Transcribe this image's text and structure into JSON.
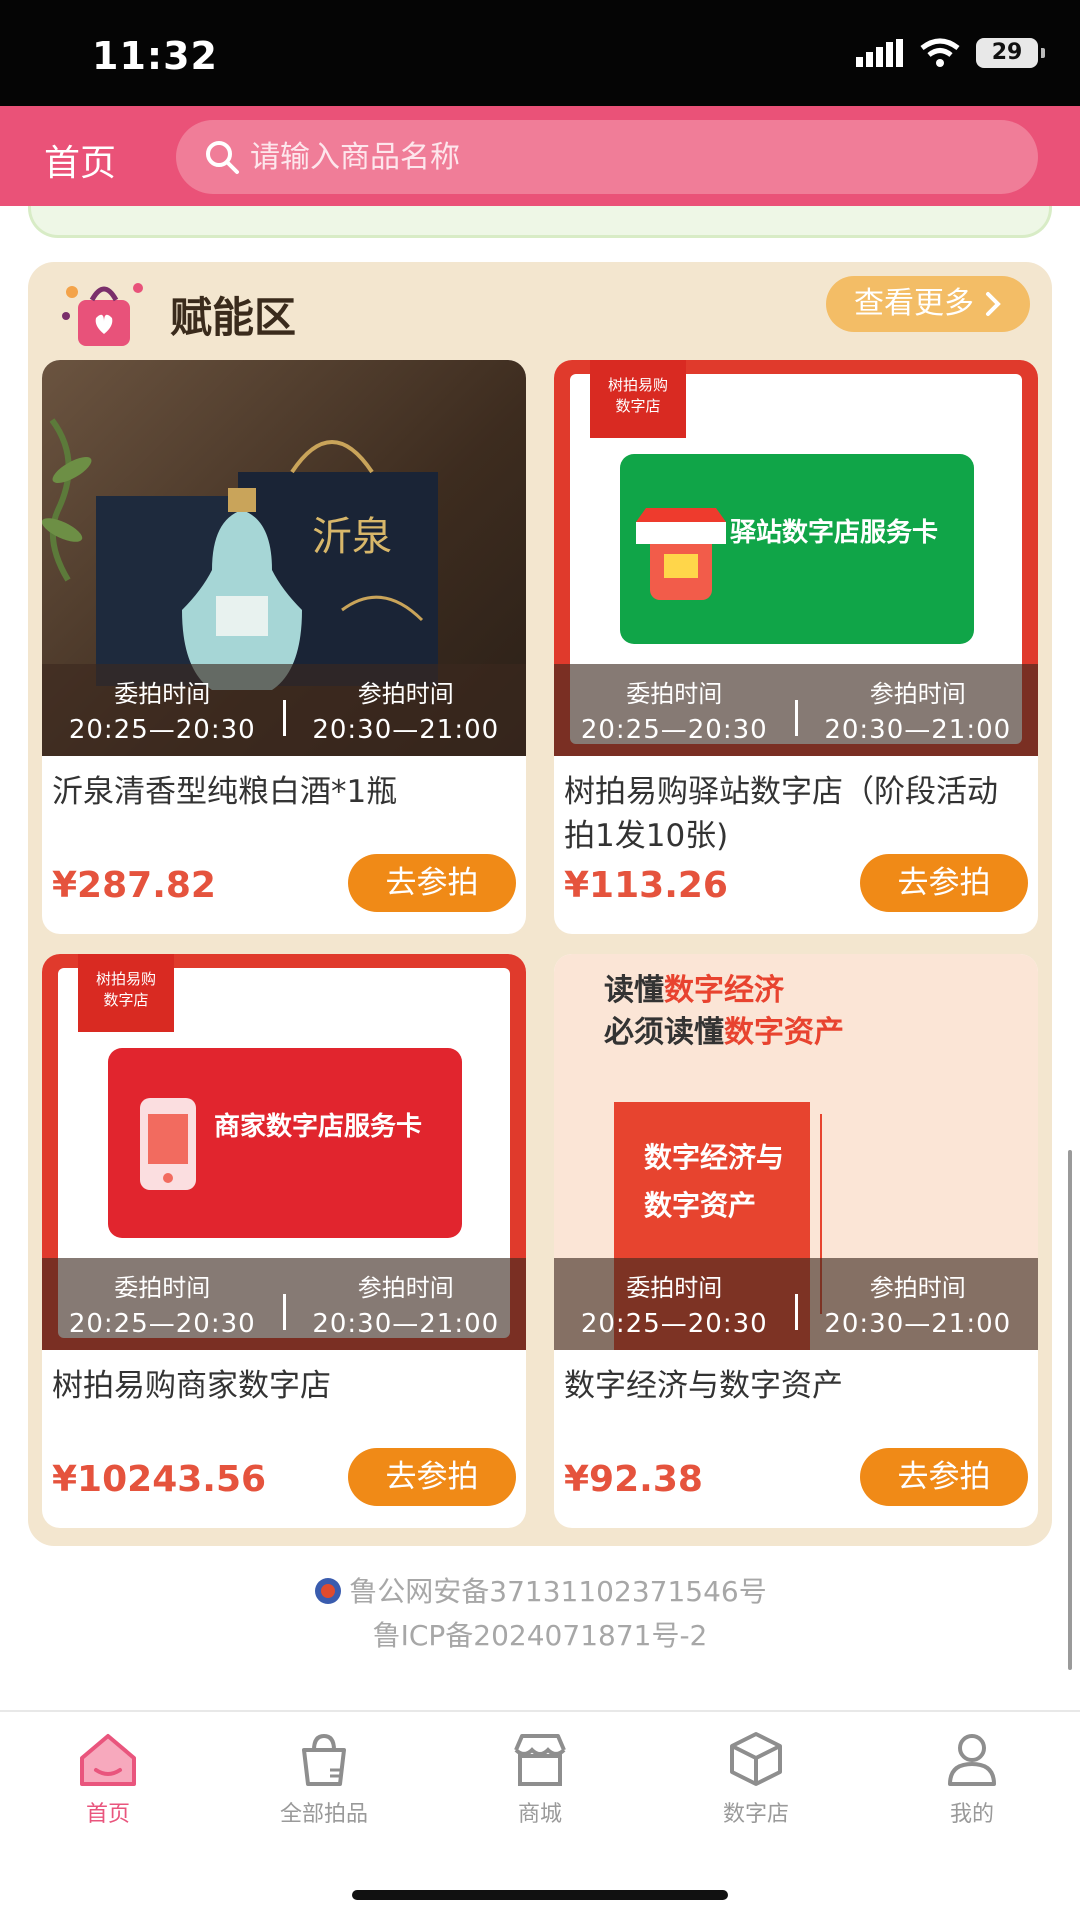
{
  "status_bar": {
    "time": "11:32",
    "battery": "29"
  },
  "header": {
    "title": "首页",
    "search_placeholder": "请输入商品名称"
  },
  "section": {
    "title": "赋能区",
    "more_label": "查看更多",
    "items": [
      {
        "name": "沂泉清香型纯粮白酒*1瓶",
        "price": "¥287.82",
        "consign_label": "委拍时间",
        "consign_time": "20:25—20:30",
        "bid_label": "参拍时间",
        "bid_time": "20:30—21:00",
        "button": "去参拍",
        "image_text": "沂泉"
      },
      {
        "name": "树拍易购驿站数字店（阶段活动拍1发10张)",
        "price": "¥113.26",
        "consign_label": "委拍时间",
        "consign_time": "20:25—20:30",
        "bid_label": "参拍时间",
        "bid_time": "20:30—21:00",
        "button": "去参拍",
        "image_text": "驿站数字店服务卡"
      },
      {
        "name": "树拍易购商家数字店",
        "price": "¥10243.56",
        "consign_label": "委拍时间",
        "consign_time": "20:25—20:30",
        "bid_label": "参拍时间",
        "bid_time": "20:30—21:00",
        "button": "去参拍",
        "image_text": "商家数字店服务卡"
      },
      {
        "name": "数字经济与数字资产",
        "price": "¥92.38",
        "consign_label": "委拍时间",
        "consign_time": "20:25—20:30",
        "bid_label": "参拍时间",
        "bid_time": "20:30—21:00",
        "button": "去参拍",
        "image_text": "数字经济与数字资产"
      }
    ],
    "image_extra": {
      "brand": "树拍易购",
      "brand_sub": "数字店",
      "book_line1_a": "读懂",
      "book_line1_b": "数字经济",
      "book_line2_a": "必须读懂",
      "book_line2_b": "数字资产"
    }
  },
  "footer": {
    "police": "鲁公网安备37131102371546号",
    "icp": "鲁ICP备2024071871号-2"
  },
  "tabbar": [
    {
      "label": "首页",
      "icon": "home-icon",
      "active": true
    },
    {
      "label": "全部拍品",
      "icon": "bag-icon",
      "active": false
    },
    {
      "label": "商城",
      "icon": "store-icon",
      "active": false
    },
    {
      "label": "数字店",
      "icon": "cube-icon",
      "active": false
    },
    {
      "label": "我的",
      "icon": "user-icon",
      "active": false
    }
  ],
  "colors": {
    "header": "#ea5278",
    "accent": "#f08a17",
    "price": "#e5533d",
    "section_bg": "#f3e6cf"
  }
}
